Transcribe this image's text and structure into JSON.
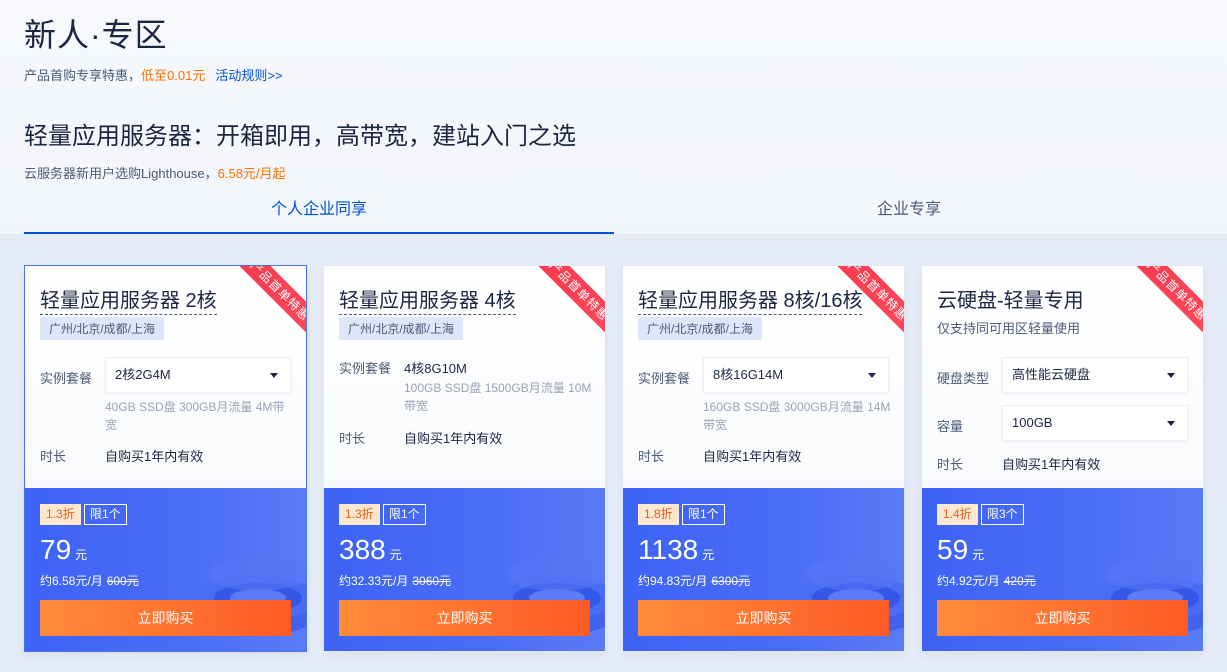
{
  "header": {
    "title": "新人·专区",
    "promo_text": "产品首购专享特惠，",
    "promo_highlight": "低至0.01元",
    "promo_link": "活动规则>>"
  },
  "section": {
    "title": "轻量应用服务器：开箱即用，高带宽，建站入门之选",
    "subtitle": "云服务器新用户选购Lighthouse，",
    "subtitle_highlight": "6.58元/月起"
  },
  "tabs": [
    {
      "label": "个人企业同享",
      "active": true
    },
    {
      "label": "企业专享",
      "active": false
    }
  ],
  "ribbon_text": "产品首单特惠",
  "cards": [
    {
      "title": "轻量应用服务器 2核",
      "region": "广州/北京/成都/上海",
      "spec_label": "实例套餐",
      "spec_value": "2核2G4M",
      "spec_detail": "40GB SSD盘 300GB月流量 4M带宽",
      "duration_label": "时长",
      "duration_value": "自购买1年内有效",
      "discount": "1.3折",
      "limit": "限1个",
      "price": "79",
      "price_unit": "元",
      "per_month": "约6.58元/月",
      "original": "600元",
      "buy_label": "立即购买"
    },
    {
      "title": "轻量应用服务器 4核",
      "region": "广州/北京/成都/上海",
      "spec_label": "实例套餐",
      "spec_value": "4核8G10M",
      "spec_detail": "100GB SSD盘 1500GB月流量 10M带宽",
      "duration_label": "时长",
      "duration_value": "自购买1年内有效",
      "discount": "1.3折",
      "limit": "限1个",
      "price": "388",
      "price_unit": "元",
      "per_month": "约32.33元/月",
      "original": "3060元",
      "buy_label": "立即购买"
    },
    {
      "title": "轻量应用服务器 8核/16核",
      "region": "广州/北京/成都/上海",
      "spec_label": "实例套餐",
      "spec_value": "8核16G14M",
      "spec_detail": "160GB SSD盘 3000GB月流量 14M带宽",
      "duration_label": "时长",
      "duration_value": "自购买1年内有效",
      "discount": "1.8折",
      "limit": "限1个",
      "price": "1138",
      "price_unit": "元",
      "per_month": "约94.83元/月",
      "original": "6300元",
      "buy_label": "立即购买"
    },
    {
      "title": "云硬盘-轻量专用",
      "desc": "仅支持同可用区轻量使用",
      "disk_type_label": "硬盘类型",
      "disk_type_value": "高性能云硬盘",
      "capacity_label": "容量",
      "capacity_value": "100GB",
      "duration_label": "时长",
      "duration_value": "自购买1年内有效",
      "discount": "1.4折",
      "limit": "限3个",
      "price": "59",
      "price_unit": "元",
      "per_month": "约4.92元/月",
      "original": "420元",
      "buy_label": "立即购买"
    }
  ],
  "colors": {
    "accent": "#0052d9",
    "highlight": "#ff7200",
    "card_bottom": "#4b6df5",
    "buy_button": "#ff6a2c",
    "ribbon": "#f8394d"
  }
}
